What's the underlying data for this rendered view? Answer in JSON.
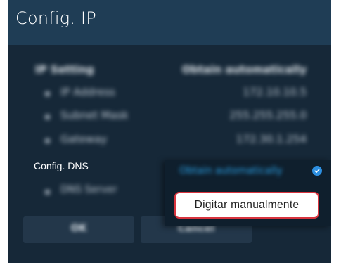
{
  "header": {
    "title": "Config. IP"
  },
  "ip_settings": {
    "label": "IP Setting",
    "value": "Obtain automatically",
    "rows": [
      {
        "label": "IP Address",
        "value": "172.10.10.5"
      },
      {
        "label": "Subnet Mask",
        "value": "255.255.255.0"
      },
      {
        "label": "Gateway",
        "value": "172.30.1.254"
      }
    ]
  },
  "dns": {
    "label": "Config. DNS",
    "server_label": "DNS Server",
    "dropdown": {
      "selected": "Obtain automatically",
      "option": "Digitar manualmente"
    }
  },
  "buttons": {
    "ok": "OK",
    "cancel": "Cancel"
  },
  "colors": {
    "panel_bg": "#162838",
    "header_bg": "#1f3d55",
    "accent": "#2d8fe0",
    "focus_border": "#d8343e"
  }
}
